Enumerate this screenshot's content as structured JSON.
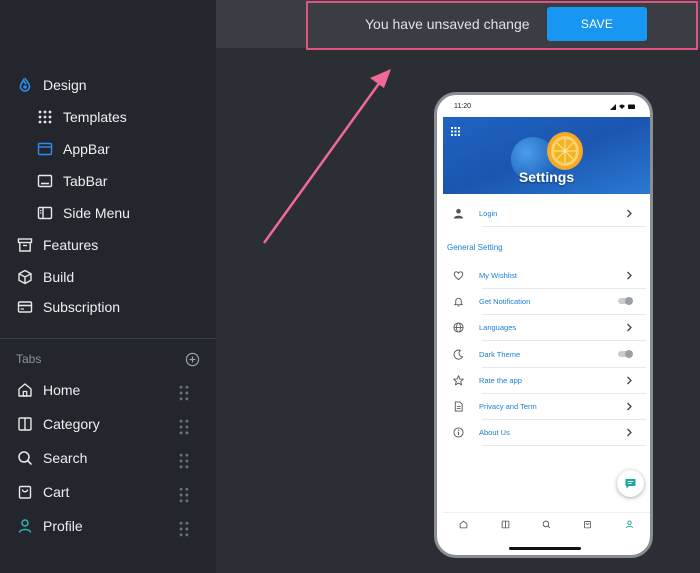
{
  "sidebar": {
    "items": [
      {
        "label": "Design",
        "icon": "design-icon"
      },
      {
        "label": "Templates",
        "icon": "templates-icon"
      },
      {
        "label": "AppBar",
        "icon": "appbar-icon"
      },
      {
        "label": "TabBar",
        "icon": "tabbar-icon"
      },
      {
        "label": "Side Menu",
        "icon": "side-menu-icon"
      },
      {
        "label": "Features",
        "icon": "features-icon"
      },
      {
        "label": "Build",
        "icon": "build-icon"
      },
      {
        "label": "Subscription",
        "icon": "subscription-icon"
      }
    ],
    "tabs_label": "Tabs",
    "tabs": [
      {
        "label": "Home",
        "icon": "home-icon"
      },
      {
        "label": "Category",
        "icon": "category-icon"
      },
      {
        "label": "Search",
        "icon": "search-icon"
      },
      {
        "label": "Cart",
        "icon": "cart-icon"
      },
      {
        "label": "Profile",
        "icon": "profile-icon"
      }
    ]
  },
  "topbar": {
    "message": "You have unsaved change",
    "save_label": "SAVE"
  },
  "phone": {
    "time": "11:20",
    "banner_title": "Settings",
    "login_label": "Login",
    "section_title": "General Setting",
    "settings": [
      {
        "label": "My Wishlist",
        "icon": "heart-icon",
        "control": "chevron"
      },
      {
        "label": "Get Notification",
        "icon": "bell-icon",
        "control": "toggle"
      },
      {
        "label": "Languages",
        "icon": "globe-icon",
        "control": "chevron"
      },
      {
        "label": "Dark Theme",
        "icon": "moon-icon",
        "control": "toggle"
      },
      {
        "label": "Rate the app",
        "icon": "star-icon",
        "control": "chevron"
      },
      {
        "label": "Privacy and Term",
        "icon": "document-icon",
        "control": "chevron"
      },
      {
        "label": "About Us",
        "icon": "info-icon",
        "control": "chevron"
      }
    ]
  },
  "colors": {
    "accent": "#1796f2",
    "highlight": "#e0557f",
    "link_blue": "#1a7fd6",
    "sidebar_bg": "#23262c",
    "canvas_bg": "#2b2e35"
  }
}
